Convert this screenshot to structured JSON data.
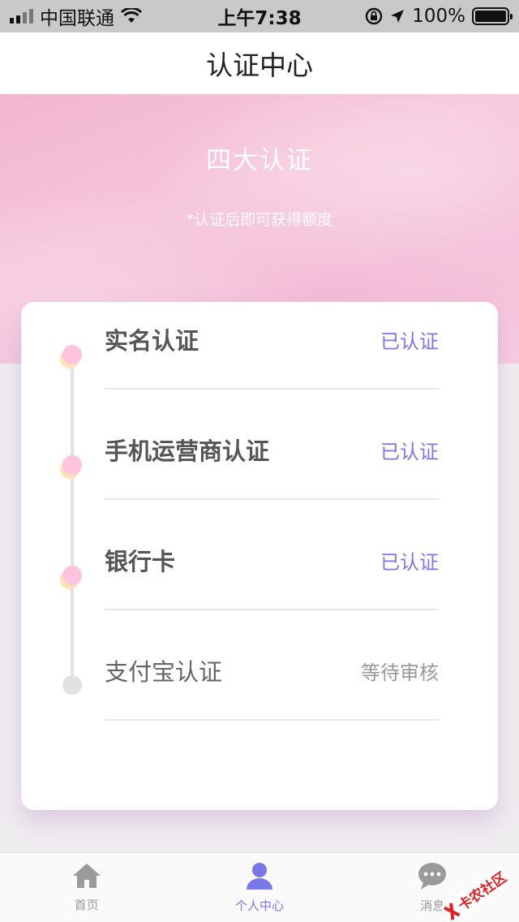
{
  "status_bar": {
    "carrier": "中国联通",
    "time": "上午7:38",
    "battery_percent": "100%",
    "battery_level": 1.0,
    "icons": [
      "signal-icon",
      "wifi-icon",
      "rotation-lock-icon",
      "location-arrow-icon",
      "battery-icon"
    ]
  },
  "nav": {
    "title": "认证中心"
  },
  "banner": {
    "title": "四大认证",
    "subtitle": "*认证后即可获得额度"
  },
  "verifications": [
    {
      "label": "实名认证",
      "status": "已认证",
      "state": "done"
    },
    {
      "label": "手机运营商认证",
      "status": "已认证",
      "state": "done"
    },
    {
      "label": "银行卡",
      "status": "已认证",
      "state": "done"
    },
    {
      "label": "支付宝认证",
      "status": "等待审核",
      "state": "pending"
    }
  ],
  "tabs": [
    {
      "label": "首页",
      "icon": "home-icon",
      "active": false
    },
    {
      "label": "个人中心",
      "icon": "person-icon",
      "active": true
    },
    {
      "label": "消息",
      "icon": "message-bubble-icon",
      "active": false
    }
  ],
  "watermark": {
    "text": "卡农社区"
  },
  "colors": {
    "accent": "#7a78e8",
    "banner_pink": "#f4bfd7",
    "dot_pink": "#ffc4dd",
    "dot_shadow": "#fbe3b8",
    "pending_gray": "#e2e2e2"
  }
}
